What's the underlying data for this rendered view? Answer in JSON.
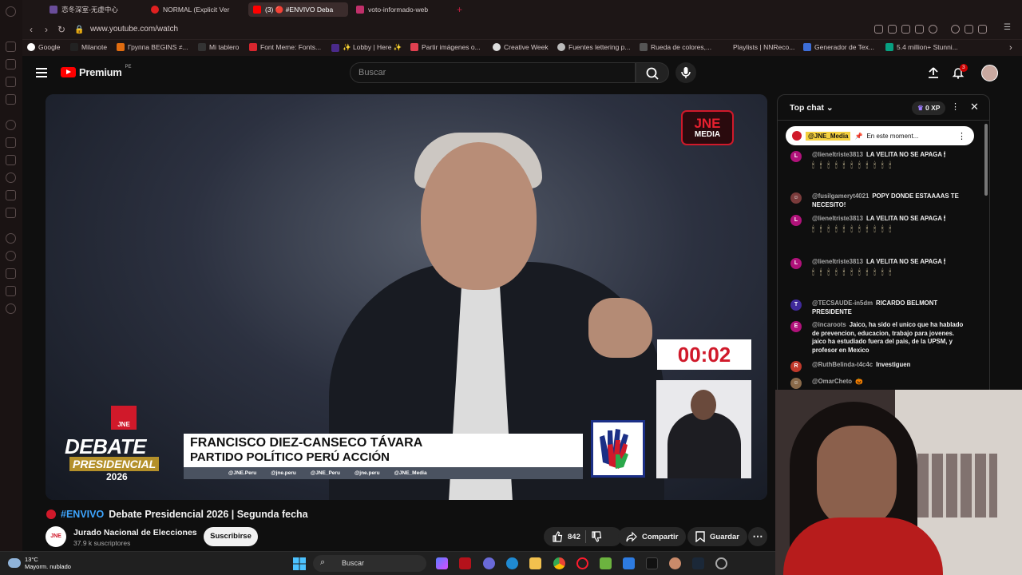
{
  "browser": {
    "tabs": [
      {
        "label": "恋冬深室-无虚中心",
        "active": false
      },
      {
        "label": "NORMAL (Explicit Ver",
        "active": false
      },
      {
        "label": "(3) 🔴 #ENVIVO Deba",
        "active": true
      },
      {
        "label": "voto-informado-web",
        "active": false
      }
    ],
    "new_tab": "+",
    "url": "www.youtube.com/watch",
    "bookmarks": [
      "Google",
      "Milanote",
      "Группа BEGINS ≠...",
      "Mi tablero",
      "Font Meme: Fonts...",
      "✨ Lobby | Here ✨",
      "Partir imágenes o...",
      "Creative Week",
      "Fuentes lettering p...",
      "Rueda de colores,...",
      "Playlists | NNReco...",
      "Generador de Tex...",
      "5.4 million+ Stunni..."
    ]
  },
  "youtube": {
    "brand": "Premium",
    "country": "PE",
    "search_placeholder": "Buscar",
    "notif_count": "3"
  },
  "video": {
    "channel_badge": "JNE",
    "channel_badge_sub": "MEDIA",
    "timer": "00:02",
    "debate_logo": {
      "top": "JNE",
      "line1": "DEBATE",
      "line2": "PRESIDENCIAL",
      "year": "2026"
    },
    "lower_third": {
      "name": "FRANCISCO DIEZ-CANSECO TÁVARA",
      "party": "PARTIDO POLÍTICO PERÚ ACCIÓN"
    },
    "socials": [
      "@JNE.Peru",
      "@jne.peru",
      "@JNE_Peru",
      "@jne.peru",
      "@JNE_Media"
    ]
  },
  "meta": {
    "live_tag": "#ENVIVO",
    "title": "Debate Presidencial 2026 | Segunda fecha",
    "channel": "Jurado Nacional de Elecciones",
    "subscribers": "37.9 k suscriptores",
    "subscribe": "Suscribirse",
    "likes": "842",
    "share": "Compartir",
    "save": "Guardar"
  },
  "chat": {
    "title": "Top chat",
    "xp": "0 XP",
    "pinned_user": "@JNE_Media",
    "pinned_text": "En este moment...",
    "messages": [
      {
        "avatar": "L",
        "color": "#b0127a",
        "user": "@lieneltriste3813",
        "text": "LA VELITA NO SE APAGA 🕯",
        "candles": "🕯🕯🕯🕯🕯🕯🕯🕯🕯🕯🕯"
      },
      {
        "avatar": "☺",
        "color": "#7a3b3b",
        "user": "@fusilgameryt4021",
        "text": "POPY DONDE ESTAAAAS TE NECESITO!",
        "candles": ""
      },
      {
        "avatar": "L",
        "color": "#b0127a",
        "user": "@lieneltriste3813",
        "text": "LA VELITA NO SE APAGA 🕯",
        "candles": "🕯🕯🕯🕯🕯🕯🕯🕯🕯🕯🕯"
      },
      {
        "avatar": "L",
        "color": "#b0127a",
        "user": "@lieneltriste3813",
        "text": "LA VELITA NO SE APAGA 🕯",
        "candles": "🕯🕯🕯🕯🕯🕯🕯🕯🕯🕯🕯"
      },
      {
        "avatar": "T",
        "color": "#3f2a9a",
        "user": "@TECSAUDE-in5dm",
        "text": "RICARDO BELMONT PRESIDENTE",
        "candles": ""
      },
      {
        "avatar": "E",
        "color": "#b0127a",
        "user": "@incaroots",
        "text": "Jaico, ha sido el unico que ha hablado de prevencion, educacion, trabajo para jovenes. jaico ha estudiado fuera del pais, de la UPSM, y profesor en Mexico",
        "candles": ""
      },
      {
        "avatar": "R",
        "color": "#c0392b",
        "user": "@RuthBelinda-t4c4c",
        "text": "Investiguen",
        "candles": ""
      },
      {
        "avatar": "☺",
        "color": "#8a6a4a",
        "user": "@OmarCheto",
        "text": "🎃",
        "candles": ""
      }
    ]
  },
  "taskbar": {
    "temp": "13°C",
    "weather": "Mayorm. nublado",
    "search": "Buscar"
  }
}
